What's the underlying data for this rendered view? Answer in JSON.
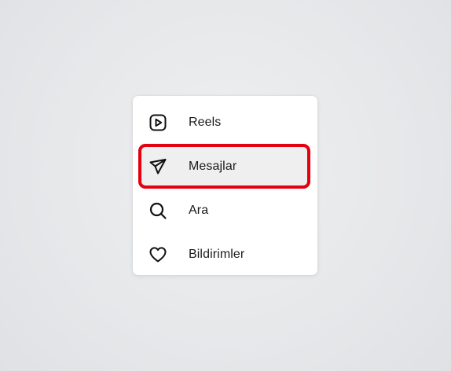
{
  "menu": {
    "items": [
      {
        "label": "Reels",
        "icon": "reels-icon"
      },
      {
        "label": "Mesajlar",
        "icon": "paper-plane-icon",
        "highlighted": true
      },
      {
        "label": "Ara",
        "icon": "search-icon"
      },
      {
        "label": "Bildirimler",
        "icon": "heart-icon"
      }
    ]
  },
  "colors": {
    "highlight": "#e3000f",
    "hover_background": "#efefef",
    "text": "#1a1a1a"
  }
}
